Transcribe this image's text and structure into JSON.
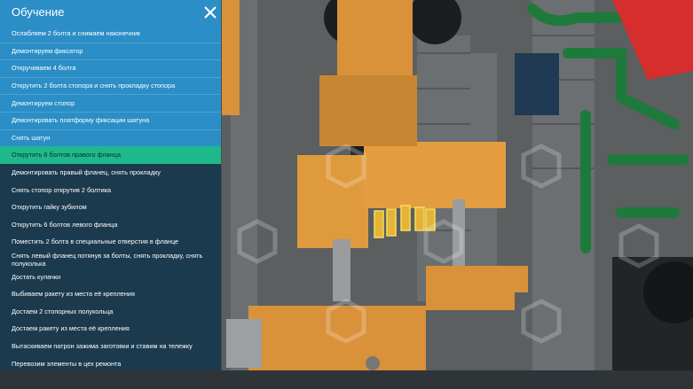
{
  "panel": {
    "title": "Обучение",
    "steps": [
      {
        "label": "Ослабляем 2 болта и снимаем наконечник",
        "state": "done"
      },
      {
        "label": "Демонтируем фиксатор",
        "state": "done"
      },
      {
        "label": "Откручиваем 4 болта",
        "state": "done"
      },
      {
        "label": "Открутить 2 болта стопора и снять прокладку стопора",
        "state": "done"
      },
      {
        "label": "Демонтируем стопор",
        "state": "done"
      },
      {
        "label": "Демонтировать платформу фиксации шатуна",
        "state": "done"
      },
      {
        "label": "Снять шатун",
        "state": "done"
      },
      {
        "label": "Открутить 6 болтов правого фланца",
        "state": "active"
      },
      {
        "label": "Демонтировать правый фланец, снять прокладку",
        "state": "todo"
      },
      {
        "label": "Снять стопор открутив 2 болтика",
        "state": "todo"
      },
      {
        "label": "Открутить гайку зубилом",
        "state": "todo"
      },
      {
        "label": "Открутить 6 болтов левого фланца",
        "state": "todo"
      },
      {
        "label": "Поместить 2 болта в специальные отверстия в фланце",
        "state": "todo"
      },
      {
        "label": "Снять левый фланец потянув за болты, снять прокладку, снять полуколька",
        "state": "todo"
      },
      {
        "label": "Достать кулачки",
        "state": "todo"
      },
      {
        "label": "Выбиваем ракету из места её крепления",
        "state": "todo"
      },
      {
        "label": "Достаем 2 стопорных полукольца",
        "state": "todo"
      },
      {
        "label": "Достаем ракету из места её крепления",
        "state": "todo"
      },
      {
        "label": "Вытаскиваем патрон зажима заготовки и ставим на тележку",
        "state": "todo"
      },
      {
        "label": "Перевозим элементы в цех ремонта",
        "state": "todo"
      }
    ]
  },
  "icons": {
    "close": "close-icon",
    "watermark": "watermark-logo"
  },
  "colors": {
    "header": "#2b8ec6",
    "done": "#2b8ec6",
    "active": "#1fb88a",
    "panel": "#1b3a4e",
    "scene_orange": "#d9913a",
    "scene_green": "#1d7a3a",
    "scene_red": "#d62d2d"
  }
}
